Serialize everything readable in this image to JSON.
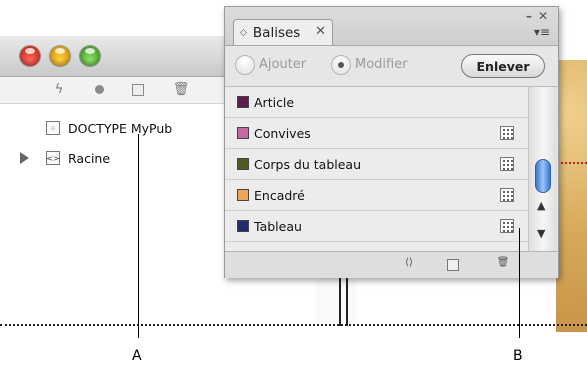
{
  "structure_panel": {
    "toolbar_icons": [
      "lightning-icon",
      "record-dot-icon",
      "new-element-icon",
      "trash-icon"
    ],
    "items": [
      {
        "label": "DOCTYPE MyPub",
        "icon": "doctype-icon"
      },
      {
        "label": "Racine",
        "icon": "tag-element-icon",
        "expanded": false
      }
    ]
  },
  "tags_panel": {
    "tab_title": "Balises",
    "options": {
      "add_label": "Ajouter",
      "modify_label": "Modifier",
      "selected": "Modifier",
      "remove_button": "Enlever"
    },
    "tags": [
      {
        "label": "Article",
        "color": "#5a1d4e",
        "has_marker": false
      },
      {
        "label": "Convives",
        "color": "#c56a9e",
        "has_marker": true
      },
      {
        "label": "Corps du tableau",
        "color": "#525a22",
        "has_marker": true
      },
      {
        "label": "Encadré",
        "color": "#f0a35a",
        "has_marker": true
      },
      {
        "label": "Tableau",
        "color": "#232a6e",
        "has_marker": true
      }
    ],
    "footer_icons": [
      "load-tags-icon",
      "new-tag-icon",
      "delete-tag-icon"
    ],
    "accent_color": "#3d79c8"
  },
  "callouts": {
    "a": "A",
    "b": "B"
  }
}
